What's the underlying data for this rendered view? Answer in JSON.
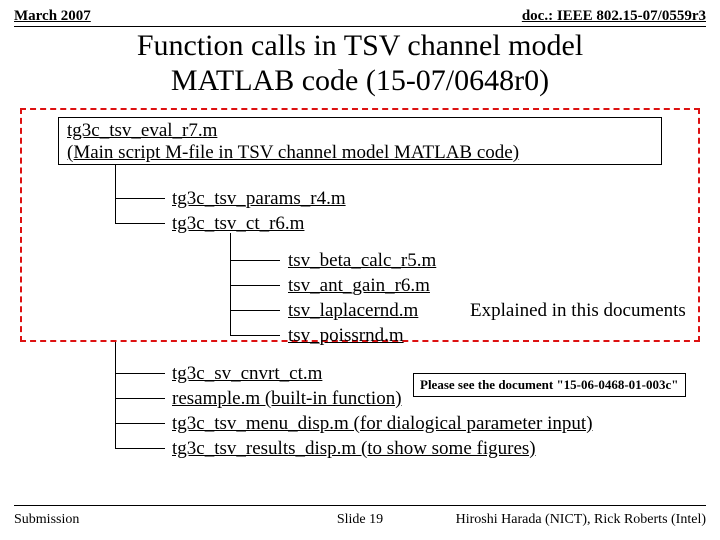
{
  "header": {
    "left": "March 2007",
    "right": "doc.: IEEE 802.15-07/0559r3"
  },
  "title_line1": "Function calls in TSV channel model",
  "title_line2": "MATLAB code (15-07/0648r0)",
  "main_file": "tg3c_tsv_eval_r7.m",
  "main_desc": "(Main script M-file in TSV channel model MATLAB code)",
  "level1": {
    "a": "tg3c_tsv_params_r4.m",
    "b": "tg3c_tsv_ct_r6.m"
  },
  "level2": {
    "a": "tsv_beta_calc_r5.m",
    "b": "tsv_ant_gain_r6.m",
    "c": "tsv_laplacernd.m",
    "d": "tsv_poissrnd.m"
  },
  "level1b": {
    "a": "tg3c_sv_cnvrt_ct.m",
    "b": "resample.m (built-in function)",
    "c": "tg3c_tsv_menu_disp.m (for dialogical parameter input)",
    "d": "tg3c_tsv_results_disp.m  (to show some figures)"
  },
  "note1": "Explained in this documents",
  "note2": "Please see the document \"15-06-0468-01-003c\"",
  "footer": {
    "left": "Submission",
    "mid": "Slide 19",
    "right": "Hiroshi Harada (NICT), Rick Roberts (Intel)"
  }
}
